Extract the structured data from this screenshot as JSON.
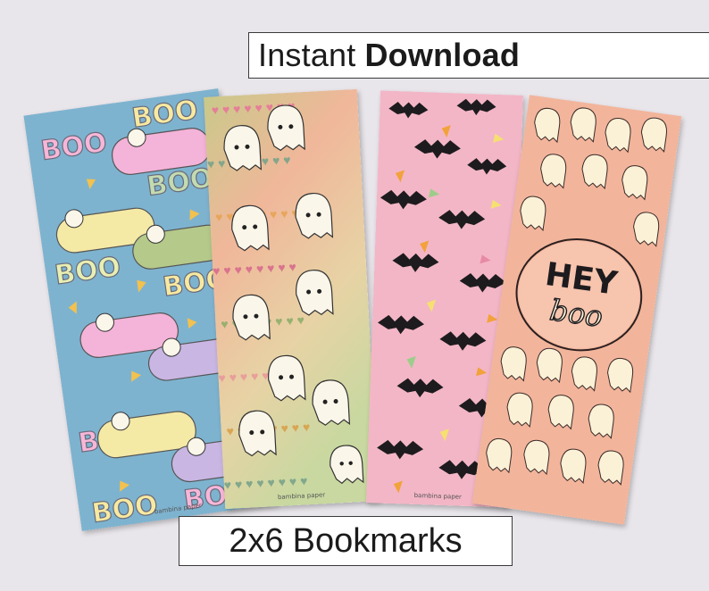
{
  "header": {
    "prefix": "Instant",
    "emphasis": "Download"
  },
  "footer": {
    "size": "2x6",
    "product": "Bookmarks"
  },
  "bookmarks": [
    {
      "name": "boo-clouds",
      "background": "#7eb3cf",
      "text": "BOO",
      "credit": "bambina paper"
    },
    {
      "name": "ghosts-hearts",
      "background": "#e9c79a",
      "credit": "bambina paper"
    },
    {
      "name": "bats-candy-corn",
      "background": "#f3b6c6",
      "credit": "bambina paper"
    },
    {
      "name": "hey-boo",
      "background": "#f2b59b",
      "line1": "HEY",
      "line2": "boo"
    }
  ],
  "colors": {
    "page_bg": "#e9e6eb",
    "ghost": "#fbf6ea",
    "bat": "#1d1b1e",
    "cloud_pink": "#f4b3d8",
    "cloud_yellow": "#f5e9a6",
    "cloud_green": "#b4c98a",
    "cloud_purple": "#c9b6e3"
  }
}
